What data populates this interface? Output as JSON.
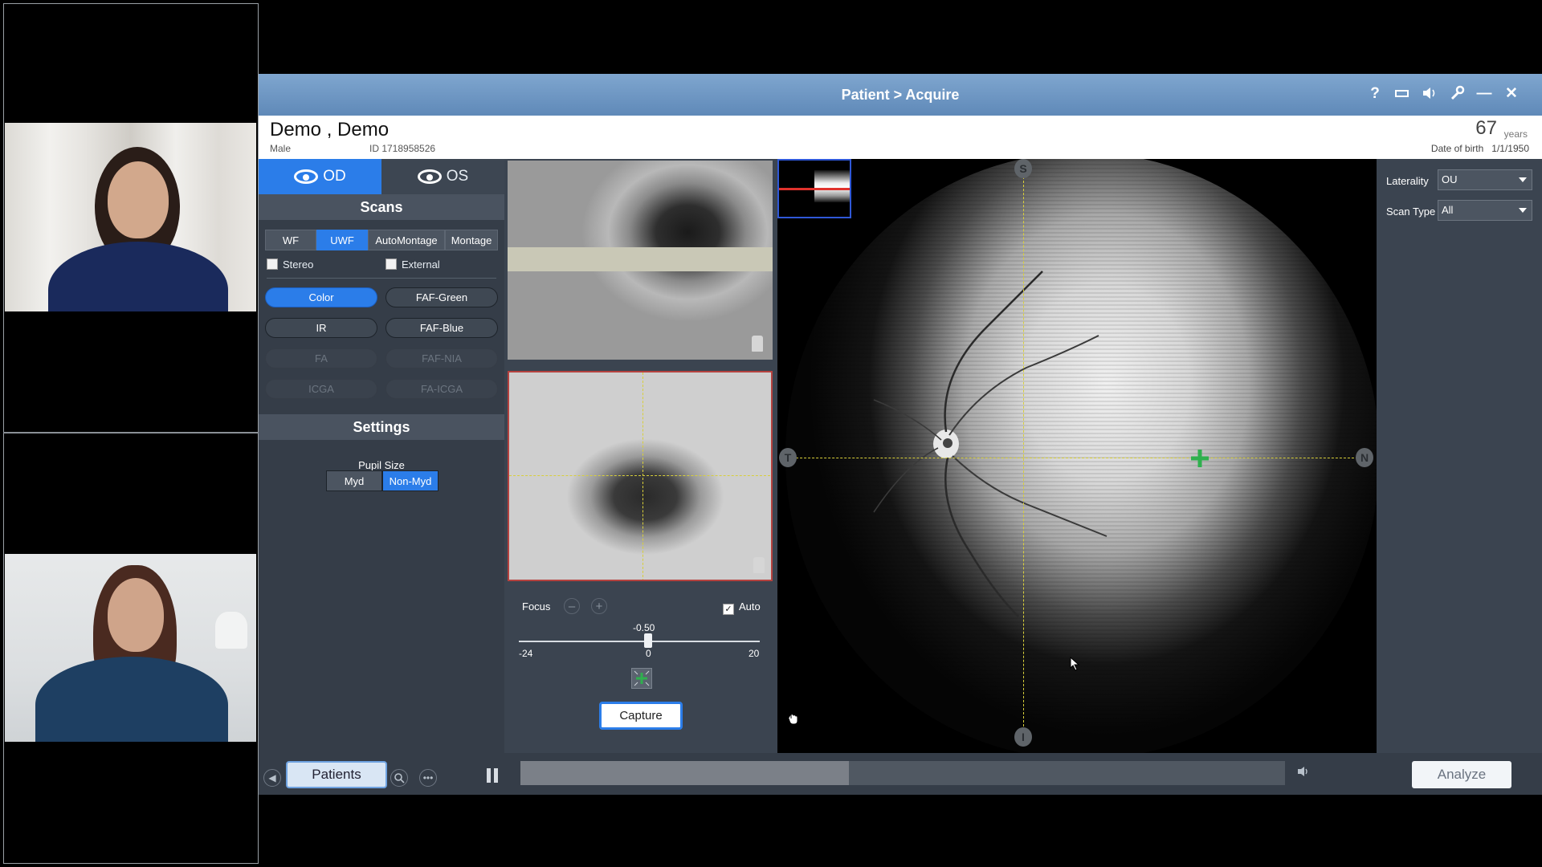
{
  "window": {
    "title": "Patient > Acquire"
  },
  "titlebar_icons": [
    "help-icon",
    "monitor-icon",
    "speaker-icon",
    "wrench-icon",
    "minimize-icon",
    "close-icon"
  ],
  "titlebar_glyphs": {
    "help": "?",
    "minimize": "—",
    "close": "✕"
  },
  "patient": {
    "name": "Demo , Demo",
    "sex": "Male",
    "id": "ID 1718958526",
    "age": "67",
    "age_unit": "years",
    "dob": "Date of birth   1/1/1950"
  },
  "eyes": {
    "od": "OD",
    "os": "OS",
    "selected": "OD"
  },
  "scans": {
    "heading": "Scans",
    "tabs": [
      "WF",
      "UWF",
      "AutoMontage",
      "Montage"
    ],
    "selected_tab": "UWF",
    "checkboxes": {
      "stereo": "Stereo",
      "external": "External"
    },
    "modes": {
      "color": "Color",
      "faf_green": "FAF-Green",
      "ir": "IR",
      "faf_blue": "FAF-Blue",
      "fa": "FA",
      "faf_nia": "FAF-NIA",
      "icga": "ICGA",
      "fa_icga": "FA-ICGA"
    },
    "selected_mode": "Color"
  },
  "settings": {
    "heading": "Settings",
    "pupil_label": "Pupil Size",
    "myd": "Myd",
    "nonmyd": "Non-Myd",
    "selected_pupil": "Non-Myd"
  },
  "focus": {
    "label": "Focus",
    "minus": "–",
    "plus": "+",
    "auto": "Auto",
    "auto_checked": true,
    "value": "-0.50",
    "min": "-24",
    "mid": "0",
    "max": "20"
  },
  "capture": "Capture",
  "fundus_markers": {
    "top": "S",
    "left": "T",
    "right": "N",
    "bottom": "I"
  },
  "right_panel": {
    "laterality_label": "Laterality",
    "laterality_value": "OU",
    "scan_type_label": "Scan Type",
    "scan_type_value": "All"
  },
  "bottom": {
    "patients": "Patients",
    "analyze": "Analyze",
    "progress_fraction": 0.43
  },
  "colors": {
    "accent": "#2b7de9",
    "titlebar": "#6f97c4",
    "panel": "#3b4450",
    "target_green": "#2fb04e",
    "crosshair": "#d8cf3a"
  }
}
